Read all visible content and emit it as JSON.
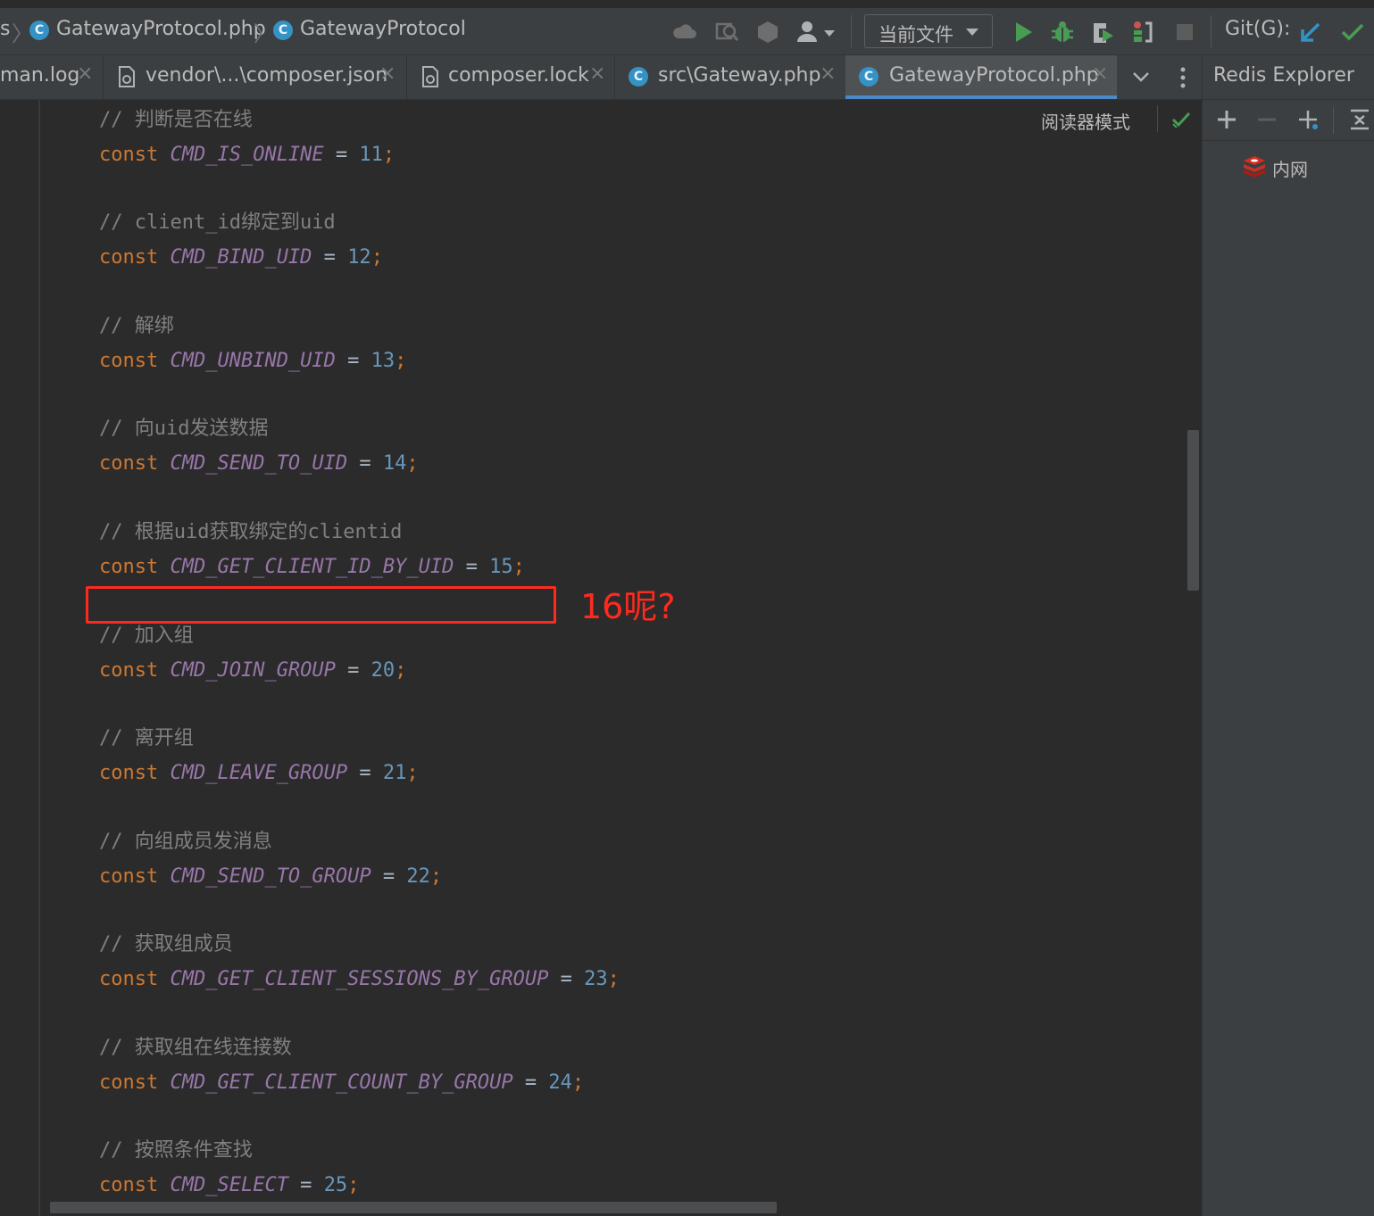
{
  "breadcrumb": {
    "cut_prefix": "s",
    "file": "GatewayProtocol.php",
    "class_name": "GatewayProtocol"
  },
  "toolbar": {
    "run_config": "当前文件",
    "git_label": "Git(G):",
    "icons": [
      "cloud-icon",
      "find-icon",
      "hexagon-icon",
      "user-icon",
      "run-icon",
      "debug-icon",
      "coverage-icon",
      "profiler-icon",
      "stop-icon",
      "git-update-icon",
      "git-commit-icon"
    ],
    "colors": {
      "run": "#499c54",
      "git_update": "#3592c4",
      "git_commit": "#499c54"
    }
  },
  "tabs": [
    {
      "label": "man.log",
      "icon": "",
      "active": false
    },
    {
      "label": "vendor\\...\\composer.json",
      "icon": "composer-file-icon",
      "active": false
    },
    {
      "label": "composer.lock",
      "icon": "composer-file-icon",
      "active": false
    },
    {
      "label": "src\\Gateway.php",
      "icon": "php-class-icon",
      "active": false
    },
    {
      "label": "GatewayProtocol.php",
      "icon": "php-class-icon",
      "active": true
    }
  ],
  "redis_panel": {
    "title": "Redis Explorer",
    "tree_item": "内网"
  },
  "editor": {
    "reader_mode": "阅读器模式",
    "lines": [
      {
        "comment": "// 判断是否在线",
        "keyword": "const",
        "name": "CMD_IS_ONLINE",
        "value": "11"
      },
      {
        "comment": "// client_id绑定到uid",
        "keyword": "const",
        "name": "CMD_BIND_UID",
        "value": "12"
      },
      {
        "comment": "// 解绑",
        "keyword": "const",
        "name": "CMD_UNBIND_UID",
        "value": "13"
      },
      {
        "comment": "// 向uid发送数据",
        "keyword": "const",
        "name": "CMD_SEND_TO_UID",
        "value": "14"
      },
      {
        "comment": "// 根据uid获取绑定的clientid",
        "keyword": "const",
        "name": "CMD_GET_CLIENT_ID_BY_UID",
        "value": "15"
      },
      {
        "comment": "// 加入组",
        "keyword": "const",
        "name": "CMD_JOIN_GROUP",
        "value": "20"
      },
      {
        "comment": "// 离开组",
        "keyword": "const",
        "name": "CMD_LEAVE_GROUP",
        "value": "21"
      },
      {
        "comment": "// 向组成员发消息",
        "keyword": "const",
        "name": "CMD_SEND_TO_GROUP",
        "value": "22"
      },
      {
        "comment": "// 获取组成员",
        "keyword": "const",
        "name": "CMD_GET_CLIENT_SESSIONS_BY_GROUP",
        "value": "23"
      },
      {
        "comment": "// 获取组在线连接数",
        "keyword": "const",
        "name": "CMD_GET_CLIENT_COUNT_BY_GROUP",
        "value": "24"
      },
      {
        "comment": "// 按照条件查找",
        "keyword": "const",
        "name": "CMD_SELECT",
        "value": "25"
      }
    ]
  },
  "annotation": {
    "text": "16呢?",
    "color": "#ff2a1f"
  }
}
